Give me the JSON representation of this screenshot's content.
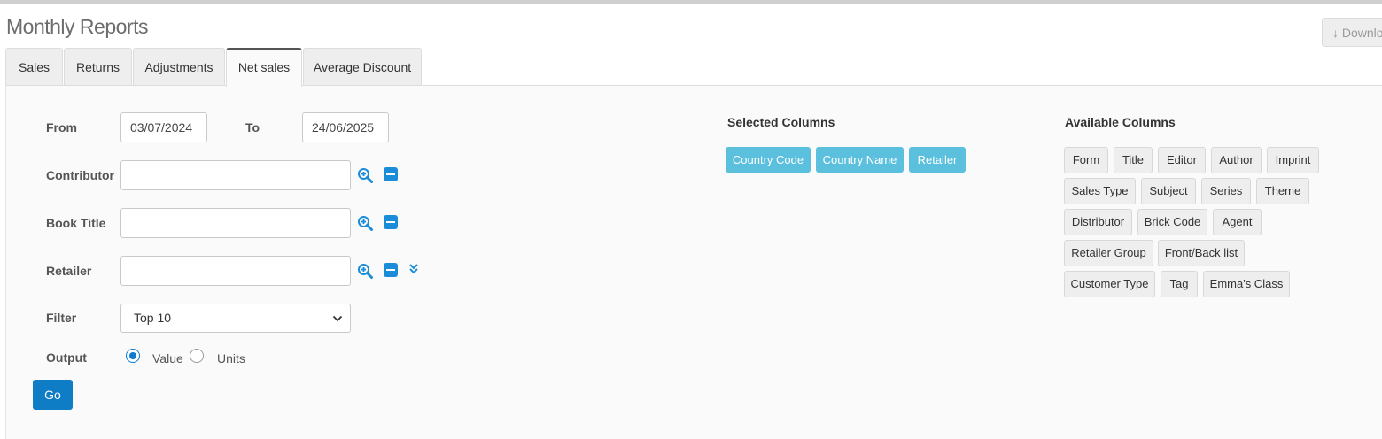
{
  "header": {
    "title": "Monthly Reports",
    "download_label": "↓ Downlo"
  },
  "tabs": [
    {
      "label": "Sales",
      "active": false
    },
    {
      "label": "Returns",
      "active": false
    },
    {
      "label": "Adjustments",
      "active": false
    },
    {
      "label": "Net sales",
      "active": true
    },
    {
      "label": "Average Discount",
      "active": false
    }
  ],
  "form": {
    "from_label": "From",
    "from_value": "03/07/2024",
    "to_label": "To",
    "to_value": "24/06/2025",
    "contributor_label": "Contributor",
    "contributor_value": "",
    "book_title_label": "Book Title",
    "book_title_value": "",
    "retailer_label": "Retailer",
    "retailer_value": "",
    "filter_label": "Filter",
    "filter_value": "Top 10",
    "output_label": "Output",
    "output_options": [
      "Value",
      "Units"
    ],
    "output_selected": "Value",
    "go_label": "Go"
  },
  "selected_columns": {
    "heading": "Selected Columns",
    "items": [
      "Country Code",
      "Country Name",
      "Retailer"
    ]
  },
  "available_columns": {
    "heading": "Available Columns",
    "items": [
      "Form",
      "Title",
      "Editor",
      "Author",
      "Imprint",
      "Sales Type",
      "Subject",
      "Series",
      "Theme",
      "Distributor",
      "Brick Code",
      "Agent",
      "Retailer Group",
      "Front/Back list",
      "Customer Type",
      "Tag",
      "Emma's Class"
    ]
  },
  "colors": {
    "primary": "#0e7dc6",
    "selected_chip": "#5bc0de",
    "icon_blue": "#1a8cd8"
  }
}
